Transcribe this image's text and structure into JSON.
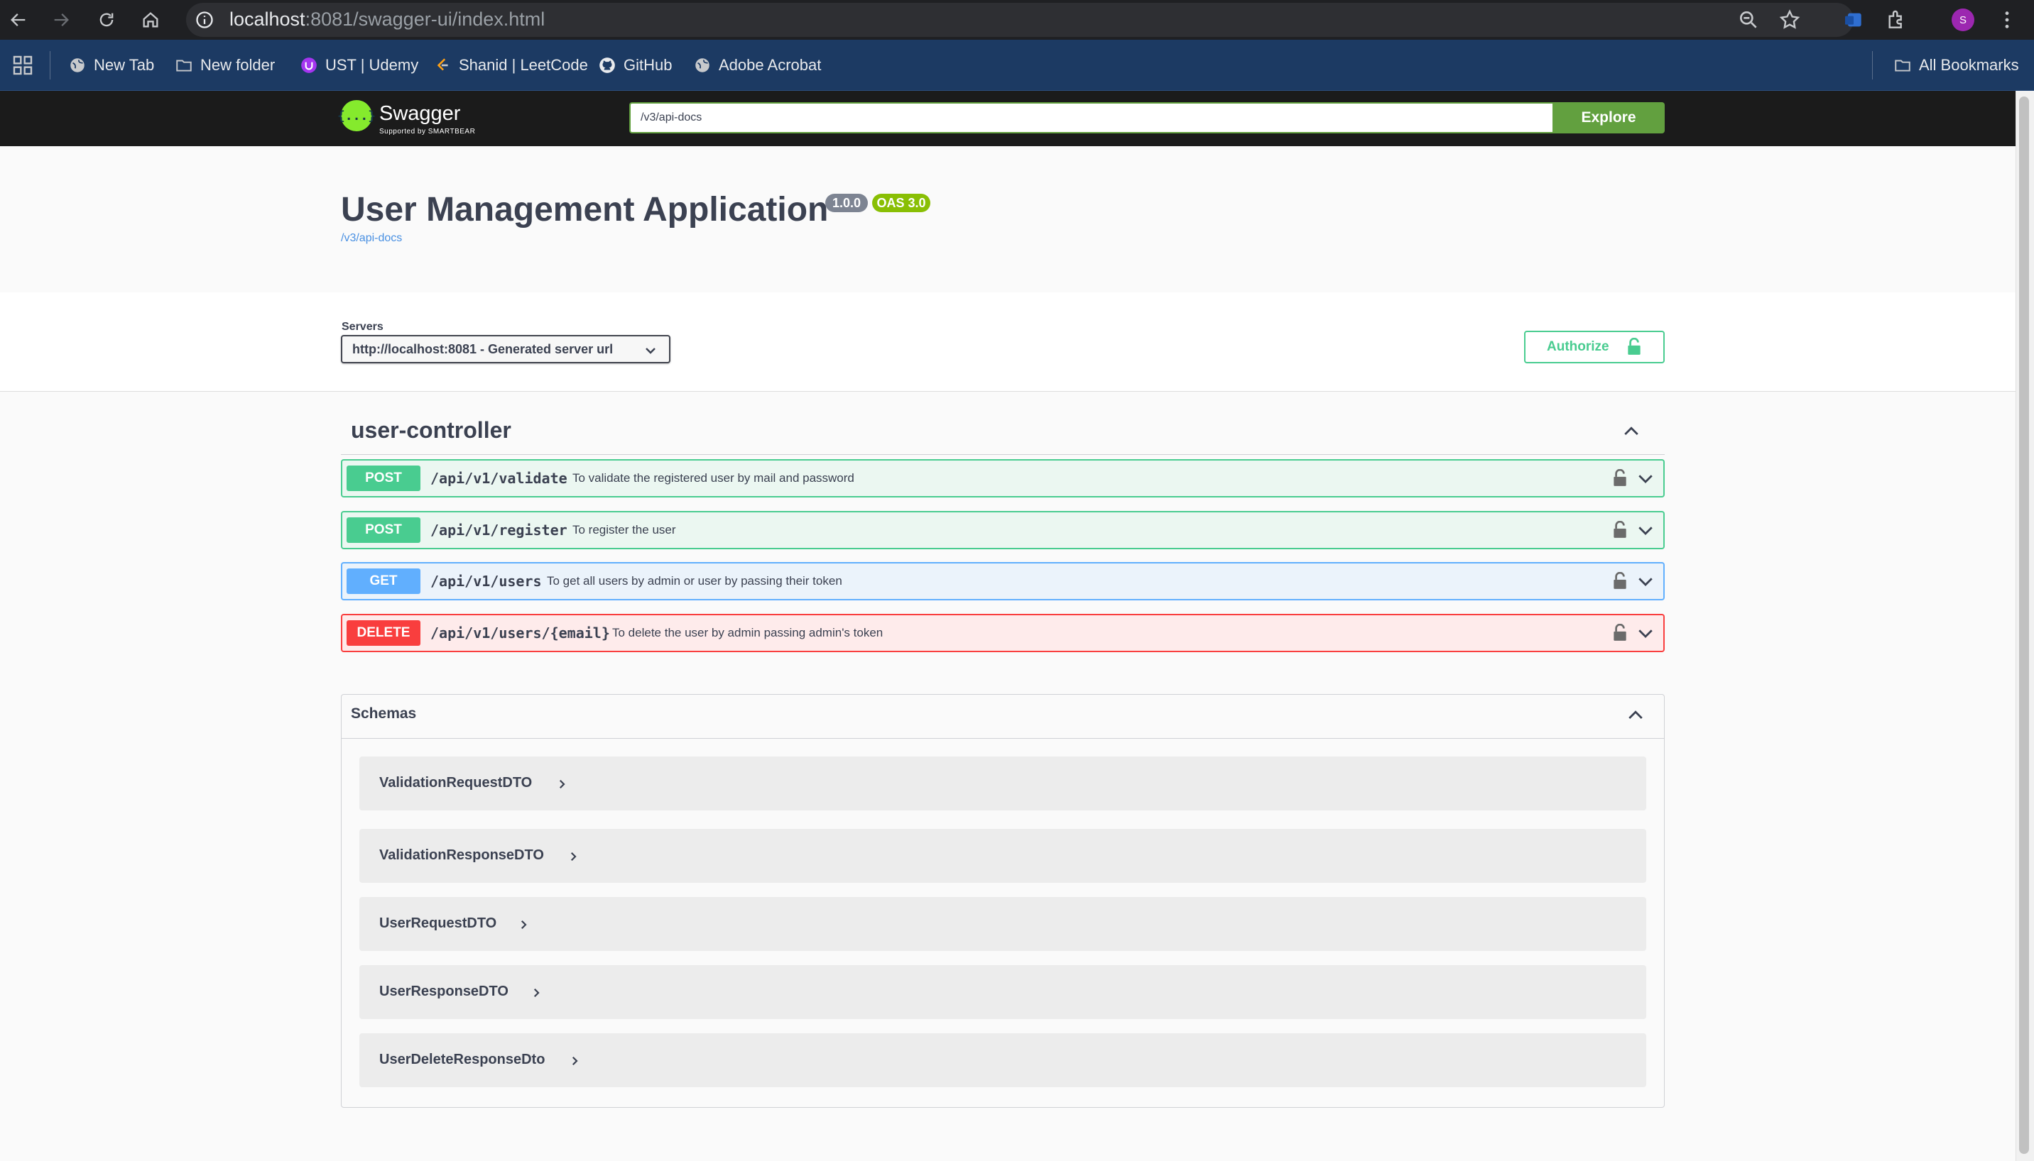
{
  "browser": {
    "url_host": "localhost",
    "url_rest": ":8081/swagger-ui/index.html",
    "profile_initial": "S",
    "bookmarks": [
      {
        "label": "New Tab",
        "icon": "globe-icon"
      },
      {
        "label": "New folder",
        "icon": "folder-icon"
      },
      {
        "label": "UST | Udemy",
        "icon": "udemy-icon"
      },
      {
        "label": "Shanid | LeetCode",
        "icon": "leetcode-icon"
      },
      {
        "label": "GitHub",
        "icon": "github-icon"
      },
      {
        "label": "Adobe Acrobat",
        "icon": "globe-icon"
      }
    ],
    "all_bookmarks_label": "All Bookmarks"
  },
  "swagger": {
    "logo_text": "Swagger",
    "logo_sub": "Supported by SMARTBEAR",
    "explore_value": "/v3/api-docs",
    "explore_label": "Explore"
  },
  "info": {
    "title": "User Management Application",
    "version": "1.0.0",
    "oas": "OAS 3.0",
    "api_link": "/v3/api-docs"
  },
  "servers": {
    "label": "Servers",
    "selected": "http://localhost:8081 - Generated server url",
    "authorize_label": "Authorize"
  },
  "tag": {
    "name": "user-controller",
    "operations": [
      {
        "method": "POST",
        "path": "/api/v1/validate",
        "summary": "To validate the registered user by mail and password"
      },
      {
        "method": "POST",
        "path": "/api/v1/register",
        "summary": "To register the user"
      },
      {
        "method": "GET",
        "path": "/api/v1/users",
        "summary": "To get all users by admin or user by passing their token"
      },
      {
        "method": "DELETE",
        "path": "/api/v1/users/{email}",
        "summary": "To delete the user by admin passing admin's token"
      }
    ]
  },
  "schemas": {
    "title": "Schemas",
    "items": [
      "ValidationRequestDTO",
      "ValidationResponseDTO",
      "UserRequestDTO",
      "UserResponseDTO",
      "UserDeleteResponseDto"
    ]
  },
  "colors": {
    "post": "#49cc90",
    "get": "#61affe",
    "delete": "#f93e3e",
    "explore": "#62a03f",
    "topbar": "#1b1b1b"
  }
}
